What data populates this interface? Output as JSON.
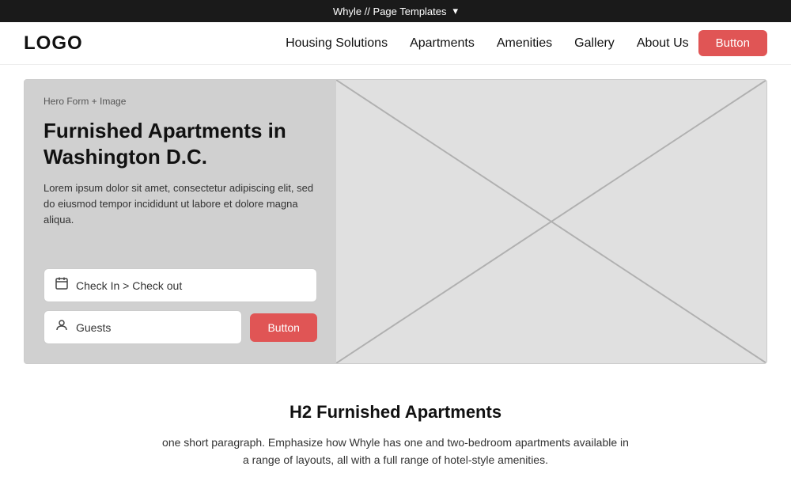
{
  "topbar": {
    "title": "Whyle // Page Templates",
    "chevron": "▾"
  },
  "nav": {
    "logo": "LOGO",
    "links": [
      {
        "label": "Housing Solutions"
      },
      {
        "label": "Apartments"
      },
      {
        "label": "Amenities"
      },
      {
        "label": "Gallery"
      },
      {
        "label": "About Us"
      }
    ],
    "button_label": "Button"
  },
  "hero": {
    "section_label": "Hero Form + Image",
    "title": "Furnished Apartments in Washington D.C.",
    "description": "Lorem ipsum dolor sit amet, consectetur adipiscing elit, sed do eiusmod tempor incididunt ut labore et dolore magna aliqua.",
    "checkin_placeholder": "Check In  >  Check out",
    "guests_placeholder": "Guests",
    "form_button_label": "Button"
  },
  "below_hero": {
    "heading": "H2 Furnished Apartments",
    "paragraph": "one short paragraph. Emphasize how Whyle has one and two-bedroom apartments available in a range of layouts, all with a full range of hotel-style amenities."
  }
}
